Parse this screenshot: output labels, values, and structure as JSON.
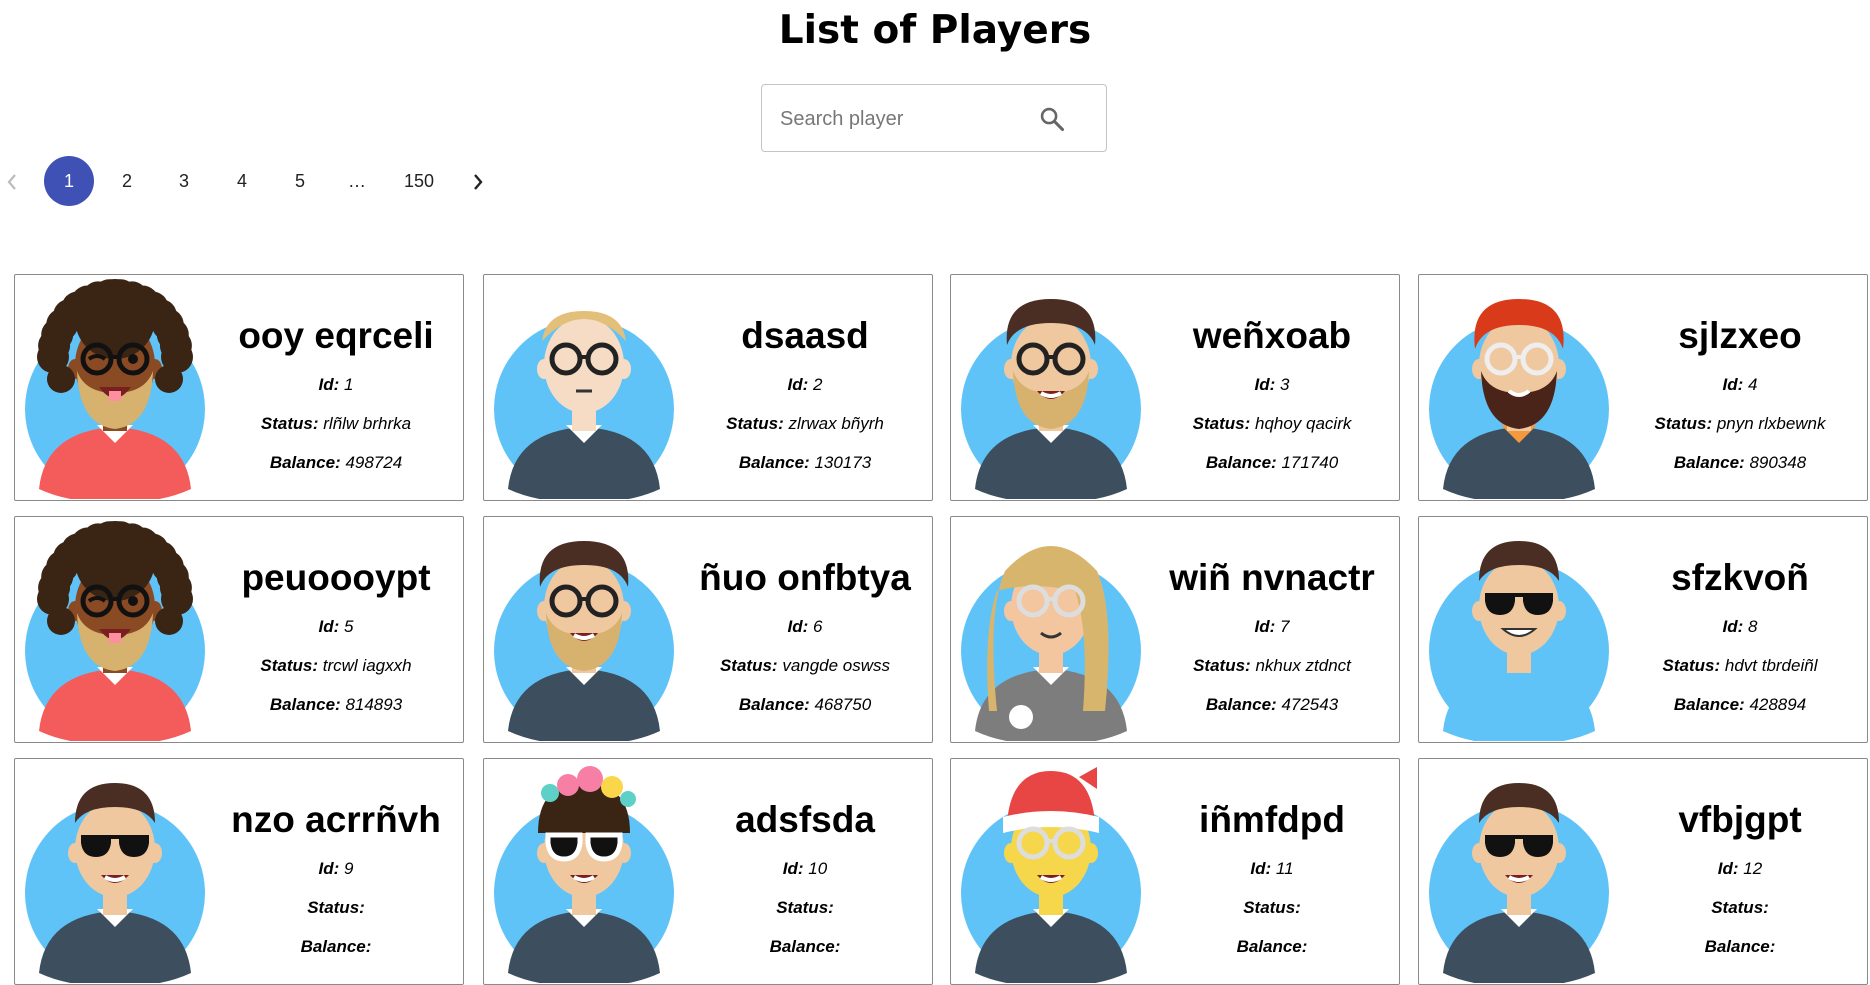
{
  "page": {
    "title": "List of Players"
  },
  "search": {
    "placeholder": "Search player"
  },
  "pagination": {
    "prev_icon": "chevron-left-icon",
    "next_icon": "chevron-right-icon",
    "pages": [
      "1",
      "2",
      "3",
      "4",
      "5",
      "…",
      "150"
    ],
    "current": "1"
  },
  "labels": {
    "id": "Id:",
    "status": "Status:",
    "balance": "Balance:"
  },
  "players": [
    {
      "name": "ooy eqrceli",
      "id": "1",
      "status": "rlñlw brhrka",
      "balance": "498724",
      "avatar": "curly-hair-winking-avatar"
    },
    {
      "name": "dsaasd",
      "id": "2",
      "status": "zlrwax bñyrh",
      "balance": "130173",
      "avatar": "blond-glasses-avatar"
    },
    {
      "name": "weñxoab",
      "id": "3",
      "status": "hqhoy qacirk",
      "balance": "171740",
      "avatar": "bearded-glasses-avatar"
    },
    {
      "name": "sjlzxeo",
      "id": "4",
      "status": "pnyn rlxbewnk",
      "balance": "890348",
      "avatar": "red-hair-beard-avatar"
    },
    {
      "name": "peuoooypt",
      "id": "5",
      "status": "trcwl iagxxh",
      "balance": "814893",
      "avatar": "curly-hair-winking-avatar"
    },
    {
      "name": "ñuo onfbtya",
      "id": "6",
      "status": "vangde oswss",
      "balance": "468750",
      "avatar": "bearded-glasses-avatar"
    },
    {
      "name": "wiñ nvnactr",
      "id": "7",
      "status": "nkhux ztdnct",
      "balance": "472543",
      "avatar": "long-blonde-hair-avatar"
    },
    {
      "name": "sfzkvoñ",
      "id": "8",
      "status": "hdvt tbrdeiñl",
      "balance": "428894",
      "avatar": "sunglasses-hoodie-avatar"
    },
    {
      "name": "nzo acrrñvh",
      "id": "9",
      "status": "",
      "balance": "",
      "avatar": "sunglasses-avatar"
    },
    {
      "name": "adsfsda",
      "id": "10",
      "status": "",
      "balance": "",
      "avatar": "flower-crown-avatar"
    },
    {
      "name": "iñmfdpd",
      "id": "11",
      "status": "",
      "balance": "",
      "avatar": "santa-hat-avatar"
    },
    {
      "name": "vfbjgpt",
      "id": "12",
      "status": "",
      "balance": "",
      "avatar": "sunglasses-avatar"
    }
  ],
  "colors": {
    "accent": "#3f51b5",
    "avatar_bg": "#5fc3f8",
    "card_border": "#8a8a8a"
  }
}
